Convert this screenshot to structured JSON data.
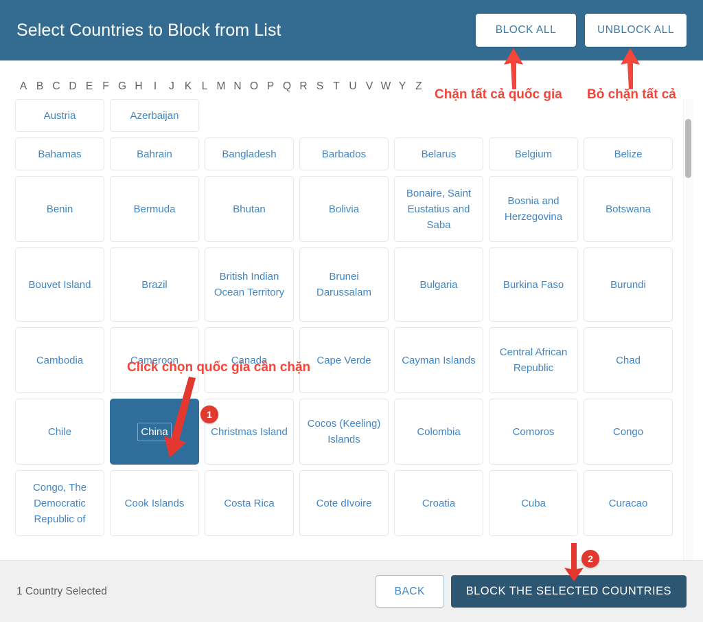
{
  "header": {
    "title": "Select Countries to Block from List",
    "block_all_label": "BLOCK ALL",
    "unblock_all_label": "UNBLOCK ALL",
    "bg_color": "#336b91"
  },
  "alphabet": [
    "A",
    "B",
    "C",
    "D",
    "E",
    "F",
    "G",
    "H",
    "I",
    "J",
    "K",
    "L",
    "M",
    "N",
    "O",
    "P",
    "Q",
    "R",
    "S",
    "T",
    "U",
    "V",
    "W",
    "Y",
    "Z"
  ],
  "grid": {
    "rows": [
      {
        "height_class": "row-h1",
        "cells": [
          {
            "label": "Austria",
            "selected": false
          },
          {
            "label": "Azerbaijan",
            "selected": false
          }
        ]
      },
      {
        "height_class": "row-h1",
        "cells": [
          {
            "label": "Bahamas",
            "selected": false
          },
          {
            "label": "Bahrain",
            "selected": false
          },
          {
            "label": "Bangladesh",
            "selected": false
          },
          {
            "label": "Barbados",
            "selected": false
          },
          {
            "label": "Belarus",
            "selected": false
          },
          {
            "label": "Belgium",
            "selected": false
          },
          {
            "label": "Belize",
            "selected": false
          }
        ]
      },
      {
        "height_class": "row-h2",
        "cells": [
          {
            "label": "Benin",
            "selected": false
          },
          {
            "label": "Bermuda",
            "selected": false
          },
          {
            "label": "Bhutan",
            "selected": false
          },
          {
            "label": "Bolivia",
            "selected": false
          },
          {
            "label": "Bonaire, Saint Eustatius and Saba",
            "selected": false
          },
          {
            "label": "Bosnia and Herzegovina",
            "selected": false
          },
          {
            "label": "Botswana",
            "selected": false
          }
        ]
      },
      {
        "height_class": "row-h3",
        "cells": [
          {
            "label": "Bouvet Island",
            "selected": false
          },
          {
            "label": "Brazil",
            "selected": false
          },
          {
            "label": "British Indian Ocean Territory",
            "selected": false
          },
          {
            "label": "Brunei Darussalam",
            "selected": false
          },
          {
            "label": "Bulgaria",
            "selected": false
          },
          {
            "label": "Burkina Faso",
            "selected": false
          },
          {
            "label": "Burundi",
            "selected": false
          }
        ]
      },
      {
        "height_class": "row-h2",
        "cells": [
          {
            "label": "Cambodia",
            "selected": false
          },
          {
            "label": "Cameroon",
            "selected": false
          },
          {
            "label": "Canada",
            "selected": false
          },
          {
            "label": "Cape Verde",
            "selected": false
          },
          {
            "label": "Cayman Islands",
            "selected": false
          },
          {
            "label": "Central African Republic",
            "selected": false
          },
          {
            "label": "Chad",
            "selected": false
          }
        ]
      },
      {
        "height_class": "row-h2",
        "cells": [
          {
            "label": "Chile",
            "selected": false
          },
          {
            "label": "China",
            "selected": true
          },
          {
            "label": "Christmas Island",
            "selected": false
          },
          {
            "label": "Cocos (Keeling) Islands",
            "selected": false
          },
          {
            "label": "Colombia",
            "selected": false
          },
          {
            "label": "Comoros",
            "selected": false
          },
          {
            "label": "Congo",
            "selected": false
          }
        ]
      },
      {
        "height_class": "row-h2",
        "cells": [
          {
            "label": "Congo, The Democratic Republic of",
            "selected": false
          },
          {
            "label": "Cook Islands",
            "selected": false
          },
          {
            "label": "Costa Rica",
            "selected": false
          },
          {
            "label": "Cote dIvoire",
            "selected": false
          },
          {
            "label": "Croatia",
            "selected": false
          },
          {
            "label": "Cuba",
            "selected": false
          },
          {
            "label": "Curacao",
            "selected": false
          }
        ]
      }
    ]
  },
  "footer": {
    "status": "1 Country Selected",
    "back_label": "BACK",
    "primary_label": "BLOCK THE SELECTED COUNTRIES"
  },
  "annotations": {
    "accent_color": "#f2463a",
    "block_all_note": "Chặn tất cả quốc gia",
    "unblock_all_note": "Bỏ chặn tất cả",
    "click_country_note": "Click chọn quốc gia cần chặn",
    "badge_one": "1",
    "badge_two": "2"
  }
}
